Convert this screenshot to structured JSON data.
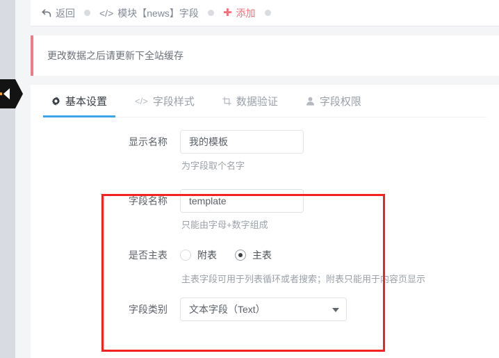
{
  "topbar": {
    "items": [
      {
        "icon": "back-arrow-icon",
        "label": "返回",
        "style": "normal"
      },
      {
        "icon": "code-icon",
        "label": "模块【news】字段",
        "style": "normal"
      },
      {
        "icon": "plus-icon",
        "label": "添加",
        "style": "accent"
      }
    ],
    "separator": "dot"
  },
  "alert": {
    "text": "更改数据之后请更新下全站缓存",
    "accent_color": "#ef7b87"
  },
  "tabs": [
    {
      "icon": "gear-icon",
      "glyph": "✿",
      "label": "基本设置",
      "active": true
    },
    {
      "icon": "code-icon",
      "glyph": "</>",
      "label": "字段样式",
      "active": false
    },
    {
      "icon": "crop-icon",
      "glyph": "⛶",
      "label": "数据验证",
      "active": false
    },
    {
      "icon": "user-icon",
      "glyph": "●",
      "label": "字段权限",
      "active": false
    }
  ],
  "form": {
    "display_name": {
      "label": "显示名称",
      "value": "我的模板",
      "placeholder": "显示名称",
      "hint": "为字段取个名字"
    },
    "field_name": {
      "label": "字段名称",
      "value": "template",
      "placeholder": "字段名称",
      "hint": "只能由字母+数字组成"
    },
    "is_main_table": {
      "label": "是否主表",
      "options": [
        {
          "label": "附表",
          "checked": false
        },
        {
          "label": "主表",
          "checked": true
        }
      ],
      "hint": "主表字段可用于列表循环或者搜索；附表只能用于内容页显示"
    },
    "field_type": {
      "label": "字段类别",
      "value": "文本字段（Text）",
      "options": [
        "文本字段（Text）"
      ]
    }
  },
  "annotation": {
    "color": "#f42121",
    "shape": "rectangle"
  },
  "colors": {
    "tab_active_underline": "#3ca5e8",
    "accent_add": "#f0707d",
    "rail": "#d8dce2",
    "page_bg": "#f4f5f7"
  }
}
